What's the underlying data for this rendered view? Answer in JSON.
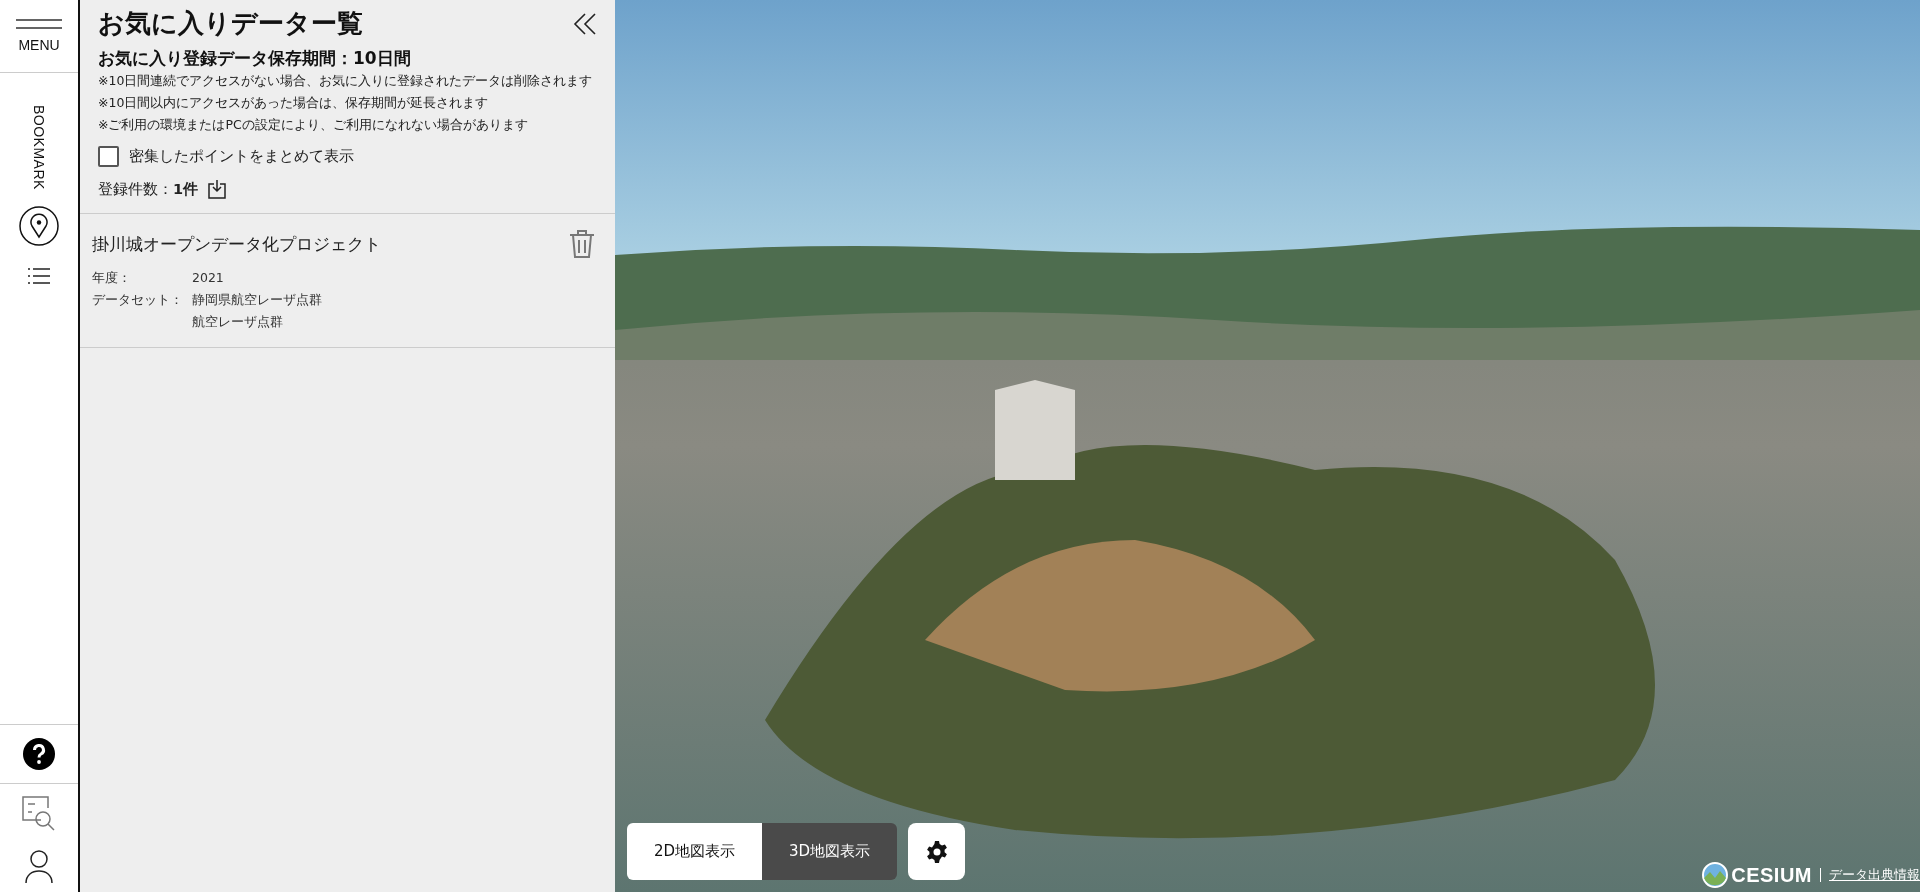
{
  "sidebar": {
    "menu_label": "MENU",
    "bookmark_label": "BOOKMARK"
  },
  "panel": {
    "title": "お気に入りデーター覧",
    "retention": "お気に入り登録データ保存期間：10日間",
    "notes": [
      "※10日間連続でアクセスがない場合、お気に入りに登録されたデータは削除されます",
      "※10日間以内にアクセスがあった場合は、保存期間が延長されます",
      "※ご利用の環境またはPCの設定により、ご利用になれない場合があります"
    ],
    "cluster_option": {
      "label": "密集したポイントをまとめて表示",
      "checked": false
    },
    "count": {
      "label": "登録件数：",
      "value": "1件"
    },
    "items": [
      {
        "title": "掛川城オープンデータ化プロジェクト",
        "fields": [
          {
            "label": "年度：",
            "values": [
              "2021"
            ]
          },
          {
            "label": "データセット：",
            "values": [
              "静岡県航空レーザ点群",
              "航空レーザ点群"
            ]
          }
        ]
      }
    ]
  },
  "map": {
    "view_modes": [
      {
        "label": "2D地図表示",
        "selected": false
      },
      {
        "label": "3D地図表示",
        "selected": true
      }
    ],
    "logo_text": "CESIUM",
    "attribution_link": "データ出典情報"
  }
}
